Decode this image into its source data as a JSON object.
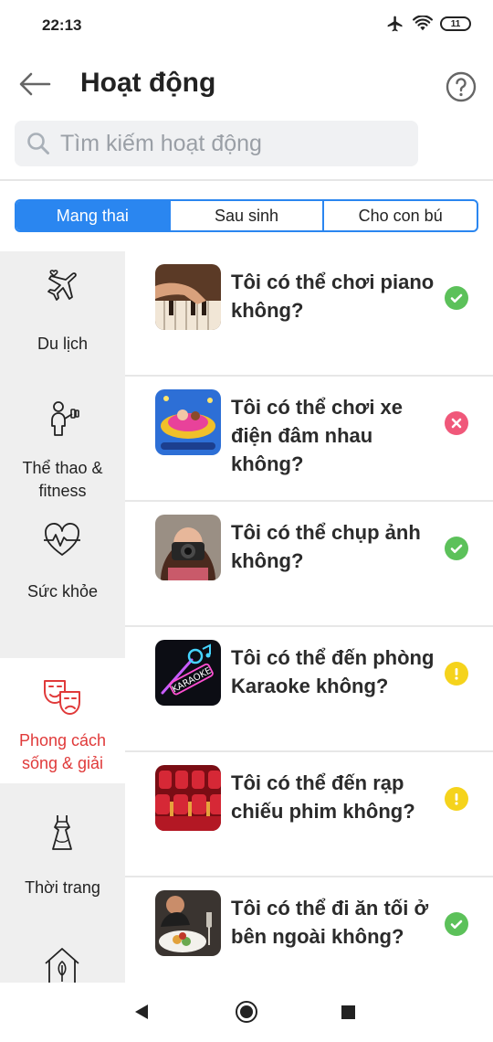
{
  "status_bar": {
    "time": "22:13",
    "battery": "11"
  },
  "header": {
    "title": "Hoạt động",
    "back_icon": "arrow-left-icon",
    "help_icon": "help-circle-icon"
  },
  "search": {
    "placeholder": "Tìm kiếm hoạt động",
    "value": ""
  },
  "tabs": [
    {
      "label": "Mang thai",
      "active": true
    },
    {
      "label": "Sau sinh",
      "active": false
    },
    {
      "label": "Cho con bú",
      "active": false
    }
  ],
  "categories": [
    {
      "label": "Du lịch",
      "icon": "airplane-heart-icon",
      "active": false
    },
    {
      "label": "Thể thao & fitness",
      "icon": "fitness-person-icon",
      "active": false
    },
    {
      "label": "Sức khỏe",
      "icon": "heart-pulse-icon",
      "active": false
    },
    {
      "label": "Phong cách sống & giải",
      "icon": "theater-masks-icon",
      "active": true
    },
    {
      "label": "Thời trang",
      "icon": "dress-icon",
      "active": false
    },
    {
      "label": "",
      "icon": "house-leaf-icon",
      "active": false
    }
  ],
  "activities": [
    {
      "title": "Tôi có thể chơi piano không?",
      "status": "ok",
      "thumb": "piano-photo"
    },
    {
      "title": "Tôi có thể chơi xe điện đâm nhau không?",
      "status": "no",
      "thumb": "bumper-car-photo"
    },
    {
      "title": "Tôi có thể chụp ảnh không?",
      "status": "ok",
      "thumb": "camera-photo"
    },
    {
      "title": "Tôi có thể đến phòng Karaoke không?",
      "status": "warn",
      "thumb": "karaoke-photo",
      "thumb_text": "KARAOKE"
    },
    {
      "title": "Tôi có thể đến rạp chiếu phim không?",
      "status": "warn",
      "thumb": "cinema-photo"
    },
    {
      "title": "Tôi có thể đi ăn tối ở bên ngoài không?",
      "status": "ok",
      "thumb": "dinner-photo"
    }
  ],
  "colors": {
    "accent": "#2a86f0",
    "active_category": "#e03a3a",
    "ok": "#5cc15a",
    "no": "#f0587a",
    "warn": "#f5d31c"
  }
}
